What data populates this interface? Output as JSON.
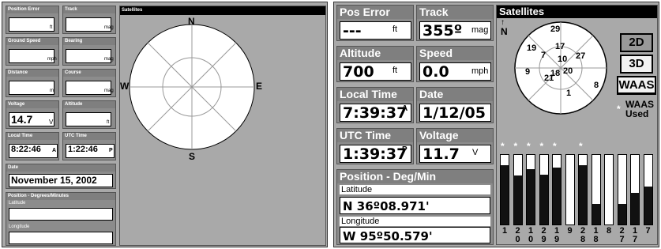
{
  "left": {
    "boxes": {
      "pos_error": {
        "label": "Position Error",
        "value": "",
        "unit": "ft"
      },
      "track": {
        "label": "Track",
        "value": "",
        "unit": "mag"
      },
      "ground_speed": {
        "label": "Ground Speed",
        "value": "",
        "unit": "mph"
      },
      "bearing": {
        "label": "Bearing",
        "value": "",
        "unit": "mag"
      },
      "distance": {
        "label": "Distance",
        "value": "",
        "unit": "mi"
      },
      "course": {
        "label": "Course",
        "value": "",
        "unit": "mag"
      },
      "voltage": {
        "label": "Voltage",
        "value": "14.7",
        "unit": "V"
      },
      "altitude": {
        "label": "Altitude",
        "value": "",
        "unit": "ft"
      },
      "local_time": {
        "label": "Local Time",
        "value": "8:22:46",
        "ampm": "A"
      },
      "utc_time": {
        "label": "UTC Time",
        "value": "1:22:46",
        "ampm": "P"
      },
      "date": {
        "label": "Date",
        "value": "November 15, 2002"
      },
      "position": {
        "label": "Position - Degrees/Minutes",
        "lat_label": "Latitude",
        "lat_value": "",
        "lon_label": "Longitude",
        "lon_value": ""
      }
    },
    "satellites": {
      "title": "Satellites",
      "n": "N",
      "e": "E",
      "s": "S",
      "w": "W"
    }
  },
  "right": {
    "boxes": {
      "pos_error": {
        "label": "Pos Error",
        "value": "---",
        "unit": "ft"
      },
      "track": {
        "label": "Track",
        "value": "355º",
        "unit": "mag"
      },
      "altitude": {
        "label": "Altitude",
        "value": "700",
        "unit": "ft"
      },
      "speed": {
        "label": "Speed",
        "value": "0.0",
        "unit": "mph"
      },
      "local_time": {
        "label": "Local Time",
        "value": "7:39:37",
        "ampm": "A"
      },
      "date": {
        "label": "Date",
        "value": "1/12/05"
      },
      "utc_time": {
        "label": "UTC Time",
        "value": "1:39:37",
        "ampm": "P"
      },
      "voltage": {
        "label": "Voltage",
        "value": "11.7",
        "unit": "V"
      },
      "position": {
        "label": "Position - Deg/Min",
        "lat_label": "Latitude",
        "lat_value": "N   36º08.971'",
        "lon_label": "Longitude",
        "lon_value": "W   95º50.579'"
      }
    },
    "satellites": {
      "title": "Satellites",
      "north": "N",
      "sky": [
        {
          "id": "29"
        },
        {
          "id": "19"
        },
        {
          "id": "7"
        },
        {
          "id": "17"
        },
        {
          "id": "10"
        },
        {
          "id": "27"
        },
        {
          "id": "9"
        },
        {
          "id": "18"
        },
        {
          "id": "20"
        },
        {
          "id": "21"
        },
        {
          "id": "8"
        },
        {
          "id": "1"
        }
      ],
      "buttons": {
        "b2d": "2D",
        "b3d": "3D",
        "waas": "WAAS"
      },
      "waas_used": "WAAS Used",
      "waas_star": "*",
      "bar_labels": [
        "1",
        "20",
        "10",
        "29",
        "19",
        "9",
        "28",
        "18",
        "8",
        "27",
        "17",
        "7"
      ],
      "bar_levels": [
        0.85,
        0.7,
        0.8,
        0.72,
        0.82,
        0.0,
        0.85,
        0.3,
        0.0,
        0.3,
        0.45,
        0.55
      ],
      "bar_stars": [
        true,
        true,
        true,
        true,
        true,
        false,
        true,
        false,
        false,
        false,
        false,
        false
      ]
    }
  }
}
